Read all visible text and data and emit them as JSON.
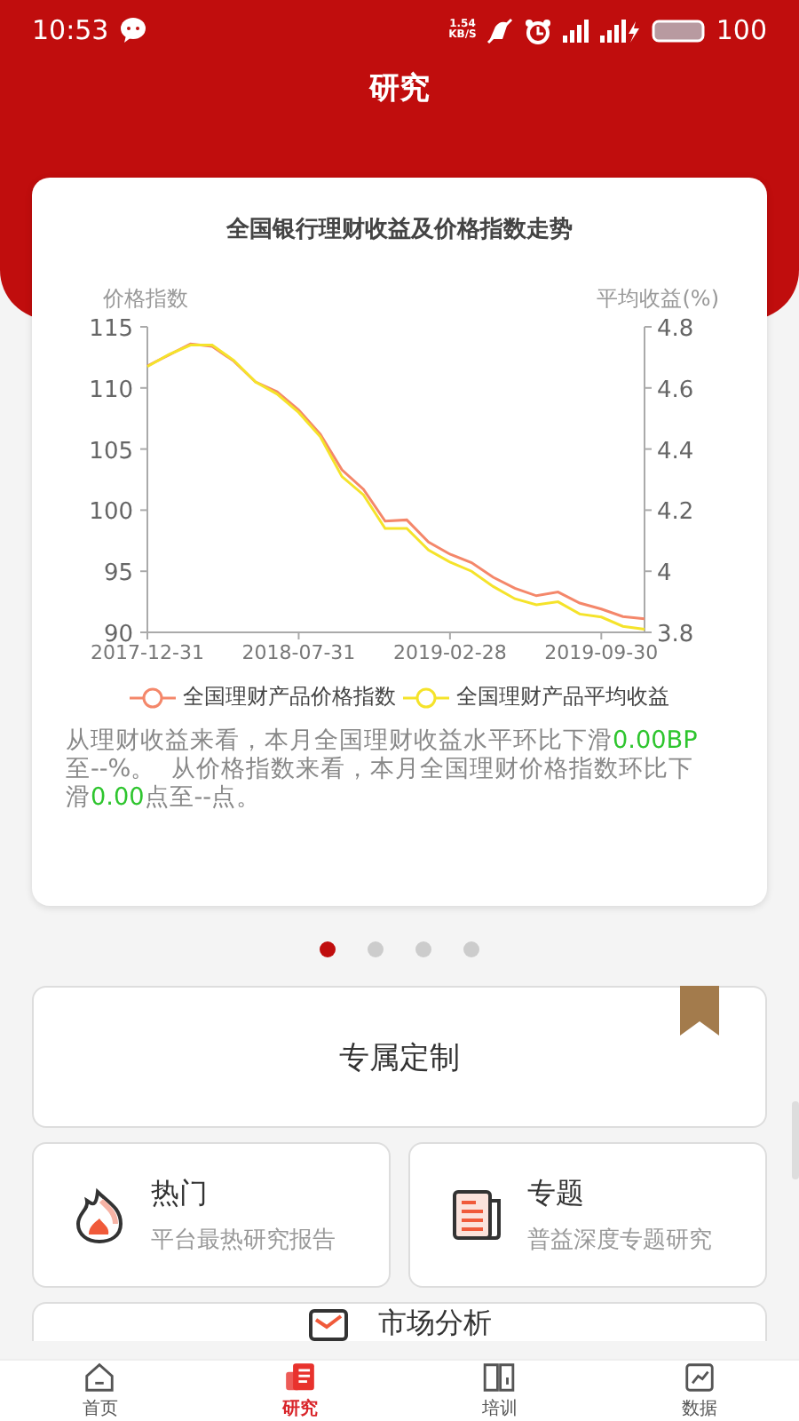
{
  "status_bar": {
    "time": "10:53",
    "speed": "1.54",
    "speed_unit": "KB/S",
    "battery": "100"
  },
  "header": {
    "title": "研究"
  },
  "chart_card": {
    "title": "全国银行理财收益及价格指数走势",
    "chart_data": {
      "type": "line",
      "ylabel": "价格指数",
      "y2label": "平均收益(%)",
      "categories": [
        "2017-12-31",
        null,
        null,
        null,
        null,
        null,
        null,
        "2018-07-31",
        null,
        null,
        null,
        null,
        null,
        null,
        "2019-02-28",
        null,
        null,
        null,
        null,
        null,
        null,
        "2019-09-30",
        null,
        null
      ],
      "ylim": [
        90,
        115
      ],
      "yticks": [
        90,
        95,
        100,
        105,
        110,
        115
      ],
      "y2lim": [
        3.8,
        4.8
      ],
      "y2ticks": [
        3.8,
        4,
        4.2,
        4.4,
        4.6,
        4.8
      ],
      "series": [
        {
          "name": "全国理财产品价格指数",
          "color": "#f4876a",
          "values": [
            111.8,
            112.7,
            113.6,
            113.4,
            112.2,
            110.5,
            109.7,
            108.2,
            106.2,
            103.3,
            101.7,
            99.1,
            99.2,
            97.4,
            96.4,
            95.7,
            94.5,
            93.6,
            93.0,
            93.3,
            92.4,
            91.9,
            91.3,
            91.1
          ]
        },
        {
          "name": "全国理财产品平均收益",
          "color": "#f5e32a",
          "axis": "y2",
          "values": [
            4.67,
            4.71,
            4.74,
            4.74,
            4.69,
            4.62,
            4.58,
            4.52,
            4.44,
            4.31,
            4.25,
            4.14,
            4.14,
            4.07,
            4.03,
            4.0,
            3.95,
            3.91,
            3.89,
            3.9,
            3.86,
            3.85,
            3.82,
            3.81
          ]
        }
      ]
    },
    "summary": [
      {
        "text": "从理财收益来看，本月全国理财收益水平环比下滑",
        "highlight": false
      },
      {
        "text": "0.00BP",
        "highlight": true
      },
      {
        "text": "至--%。  从价格指数来看，本月全国理财价格指数环比下滑",
        "highlight": false
      },
      {
        "text": "0.00",
        "highlight": true
      },
      {
        "text": "点至--点。",
        "highlight": false
      }
    ]
  },
  "pager": [
    {
      "selected": true
    },
    {
      "selected": false
    },
    {
      "selected": false
    },
    {
      "selected": false
    }
  ],
  "custom_card": {
    "label": "专属定制"
  },
  "features": [
    {
      "kind": "flame",
      "title": "热门",
      "subtitle": "平台最热研究报告"
    },
    {
      "kind": "document",
      "title": "专题",
      "subtitle": "普益深度专题研究"
    }
  ],
  "partial_card": {
    "title": "市场分析"
  },
  "nav": [
    {
      "kind": "home",
      "label": "首页",
      "selected": false
    },
    {
      "kind": "research",
      "label": "研究",
      "selected": true
    },
    {
      "kind": "book",
      "label": "培训",
      "selected": false
    },
    {
      "kind": "data",
      "label": "数据",
      "selected": false
    }
  ]
}
